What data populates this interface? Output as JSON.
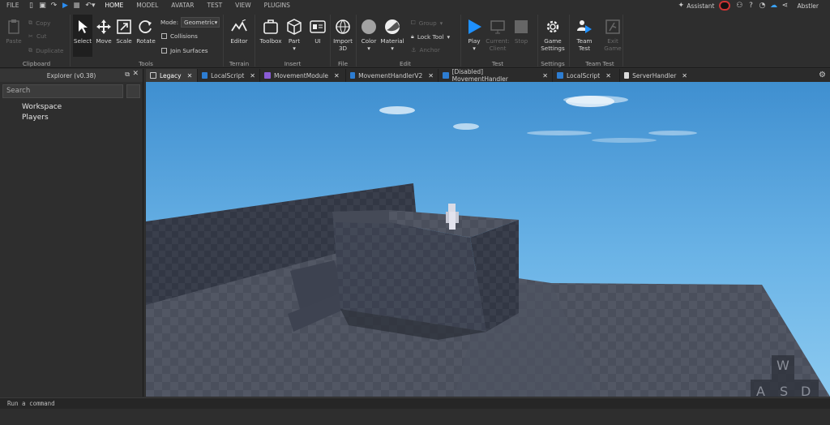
{
  "topbar": {
    "file": "FILE",
    "menus": [
      "HOME",
      "MODEL",
      "AVATAR",
      "TEST",
      "VIEW",
      "PLUGINS"
    ],
    "assistant": "Assistant",
    "user": "Abstler"
  },
  "ribbon": {
    "clipboard": {
      "paste": "Paste",
      "copy": "Copy",
      "cut": "Cut",
      "duplicate": "Duplicate",
      "group": "Clipboard"
    },
    "tools": {
      "select": "Select",
      "move": "Move",
      "scale": "Scale",
      "rotate": "Rotate",
      "mode_label": "Mode:",
      "mode_value": "Geometric",
      "collisions": "Collisions",
      "join_surfaces": "Join Surfaces",
      "group": "Tools"
    },
    "terrain": {
      "editor": "Editor",
      "group": "Terrain"
    },
    "insert": {
      "toolbox": "Toolbox",
      "part": "Part",
      "ui": "UI",
      "group": "Insert"
    },
    "file": {
      "import": "Import",
      "import2": "3D",
      "group": "File"
    },
    "edit": {
      "color": "Color",
      "material": "Material",
      "group_btn": "Group",
      "lock_tool": "Lock Tool",
      "anchor": "Anchor",
      "group": "Edit"
    },
    "test": {
      "play": "Play",
      "current": "Current:",
      "client": "Client",
      "stop": "Stop",
      "group": "Test"
    },
    "settings": {
      "game": "Game",
      "settings": "Settings",
      "group": "Settings"
    },
    "teamtest": {
      "team": "Team",
      "test": "Test",
      "exit": "Exit",
      "game": "Game",
      "group": "Team Test"
    }
  },
  "explorer": {
    "title": "Explorer (v0.38)",
    "search_placeholder": "Search",
    "items": [
      "Workspace",
      "Players"
    ]
  },
  "tabs": [
    {
      "label": "Legacy",
      "icon": "viewport-icon"
    },
    {
      "label": "LocalScript",
      "icon": "localscript-icon"
    },
    {
      "label": "MovementModule",
      "icon": "modulescript-icon"
    },
    {
      "label": "MovementHandlerV2",
      "icon": "localscript-icon"
    },
    {
      "label": "[Disabled] MovementHandler",
      "icon": "localscript-icon"
    },
    {
      "label": "LocalScript",
      "icon": "localscript-icon"
    },
    {
      "label": "ServerHandler",
      "icon": "script-icon"
    }
  ],
  "viewport": {
    "keys": [
      "W",
      "A",
      "S",
      "D"
    ]
  },
  "command": {
    "placeholder": "Run a command"
  },
  "colors": {
    "accent": "#1e90ff",
    "panel": "#2e2e2e",
    "sky": "#5ab0e6"
  }
}
